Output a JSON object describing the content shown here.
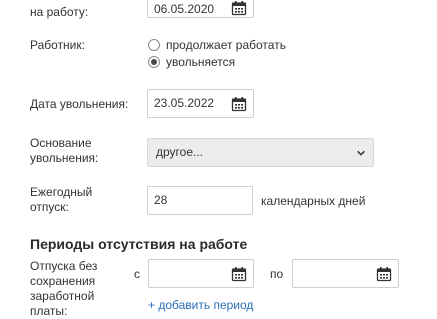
{
  "hire": {
    "label_partial": "на работу:",
    "value": "06.05.2020"
  },
  "employee": {
    "label": "Работник:",
    "options": [
      {
        "label": "продолжает работать",
        "checked": false
      },
      {
        "label": "увольняется",
        "checked": true
      }
    ]
  },
  "dismissal": {
    "label": "Дата увольнения:",
    "value": "23.05.2022"
  },
  "reason": {
    "label_line1": "Основание",
    "label_line2": "увольнения:",
    "selected": "другое..."
  },
  "vacation": {
    "label_line1": "Ежегодный",
    "label_line2": "отпуск:",
    "value": "28",
    "unit": "календарных дней"
  },
  "absence": {
    "title": "Периоды отсутствия на работе",
    "label_lines": [
      "Отпуска без",
      "сохранения",
      "заработной",
      "платы:"
    ],
    "from_label": "с",
    "to_label": "по",
    "from_value": "",
    "to_value": "",
    "add_link": "+ добавить период"
  }
}
